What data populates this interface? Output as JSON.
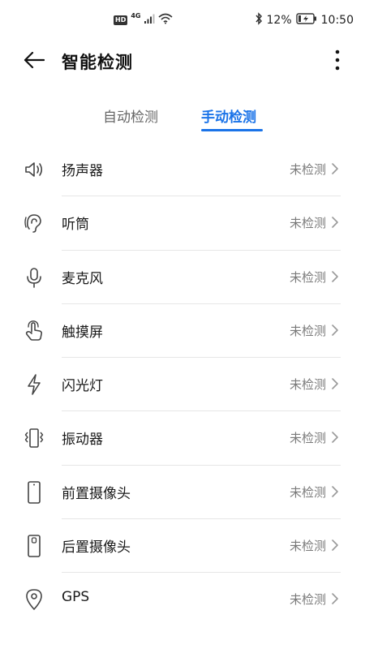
{
  "status_bar": {
    "hd": "HD",
    "network": "4G",
    "battery_percent": "12%",
    "time": "10:50",
    "icons": [
      "signal-icon",
      "wifi-icon",
      "bluetooth-icon",
      "battery-charging-icon"
    ]
  },
  "header": {
    "title": "智能检测",
    "back_icon": "back-arrow-icon",
    "more_icon": "more-vertical-icon"
  },
  "tabs": [
    {
      "label": "自动检测",
      "active": false
    },
    {
      "label": "手动检测",
      "active": true
    }
  ],
  "accent_color": "#1a73e8",
  "items": [
    {
      "label": "扬声器",
      "status": "未检测",
      "icon": "speaker-icon"
    },
    {
      "label": "听筒",
      "status": "未检测",
      "icon": "earpiece-icon"
    },
    {
      "label": "麦克风",
      "status": "未检测",
      "icon": "microphone-icon"
    },
    {
      "label": "触摸屏",
      "status": "未检测",
      "icon": "touch-icon"
    },
    {
      "label": "闪光灯",
      "status": "未检测",
      "icon": "flash-icon"
    },
    {
      "label": "振动器",
      "status": "未检测",
      "icon": "vibration-icon"
    },
    {
      "label": "前置摄像头",
      "status": "未检测",
      "icon": "front-camera-icon"
    },
    {
      "label": "后置摄像头",
      "status": "未检测",
      "icon": "rear-camera-icon"
    },
    {
      "label": "GPS",
      "status": "未检测",
      "icon": "location-pin-icon"
    }
  ]
}
